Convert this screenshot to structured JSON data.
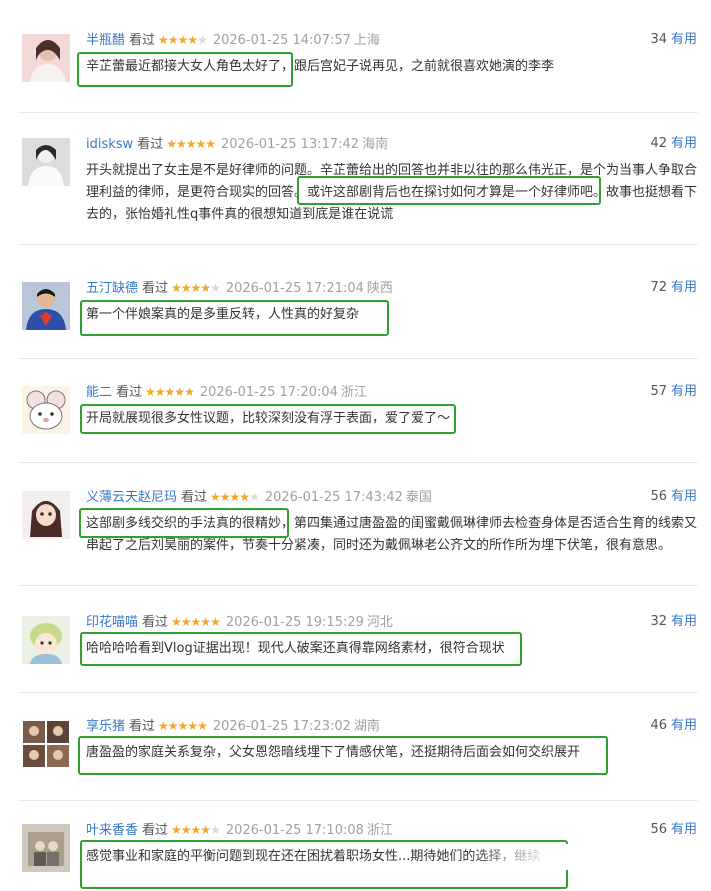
{
  "useful_label": "有用",
  "watched_label": "看过",
  "reviews": [
    {
      "user": "半瓶醋",
      "rating": 4,
      "time": "2026-01-25 14:07:57",
      "location": "上海",
      "useful_count": "34",
      "content": "辛芷蕾最近都接大女人角色太好了，跟后宫妃子说再见，之前就很喜欢她演的李李"
    },
    {
      "user": "idisksw",
      "rating": 5,
      "time": "2026-01-25 13:17:42",
      "location": "海南",
      "useful_count": "42",
      "content": "开头就提出了女主是不是好律师的问题。辛芷蕾给出的回答也并非以往的那么伟光正，是个为当事人争取合理利益的律师，是更符合现实的回答。或许这部剧背后也在探讨如何才算是一个好律师吧。故事也挺想看下去的，张怡婚礼性q事件真的很想知道到底是谁在说谎"
    },
    {
      "user": "五汀缺德",
      "rating": 4,
      "time": "2026-01-25 17:21:04",
      "location": "陕西",
      "useful_count": "72",
      "content": "第一个伴娘案真的是多重反转，人性真的好复杂"
    },
    {
      "user": "能二",
      "rating": 5,
      "time": "2026-01-25 17:20:04",
      "location": "浙江",
      "useful_count": "57",
      "content": "开局就展现很多女性议题，比较深刻没有浮于表面，爱了爱了～"
    },
    {
      "user": "义薄云天赵尼玛",
      "rating": 4,
      "time": "2026-01-25 17:43:42",
      "location": "泰国",
      "useful_count": "56",
      "content": "这部剧多线交织的手法真的很精妙，第四集通过唐盈盈的闺蜜戴佩琳律师去检查身体是否适合生育的线索又串起了之后刘昊丽的案件，节奏十分紧凑，同时还为戴佩琳老公齐文的所作所为埋下伏笔，很有意思。"
    },
    {
      "user": "印花喵喵",
      "rating": 5,
      "time": "2026-01-25 19:15:29",
      "location": "河北",
      "useful_count": "32",
      "content": "哈哈哈哈看到Vlog证据出现！现代人破案还真得靠网络素材，很符合现状"
    },
    {
      "user": "享乐猪",
      "rating": 5,
      "time": "2026-01-25 17:23:02",
      "location": "湖南",
      "useful_count": "46",
      "content": "唐盈盈的家庭关系复杂，父女恩怨暗线埋下了情感伏笔，还挺期待后面会如何交织展开"
    },
    {
      "user": "叶来香香",
      "rating": 4,
      "time": "2026-01-25 17:10:08",
      "location": "浙江",
      "useful_count": "56",
      "content": "感觉事业和家庭的平衡问题到现在还在困扰着职场女性...期待她们的选择，继续"
    }
  ],
  "colors": {
    "username": "#3a77c9",
    "star": "#f5a623",
    "highlight": "#2ea12e",
    "meta": "#a0a0a0"
  }
}
